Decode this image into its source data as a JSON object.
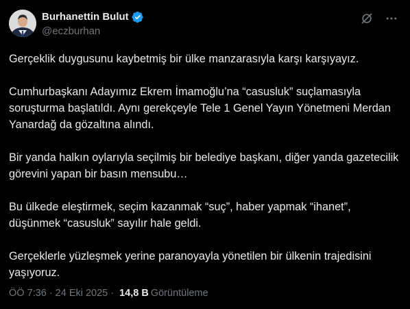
{
  "author": {
    "display_name": "Burhanettin Bulut",
    "handle": "@eczburhan",
    "verified_color": "#1d9bf0"
  },
  "header_actions": [
    "grok-icon",
    "more-icon"
  ],
  "post": {
    "paragraphs": [
      "Gerçeklik duygusunu kaybetmiş bir ülke manzarasıyla karşı karşıyayız.",
      "Cumhurbaşkanı Adayımız Ekrem İmamoğlu’na “casusluk” suçlamasıyla soruşturma başlatıldı. Aynı gerekçeyle Tele 1 Genel Yayın Yönetmeni Merdan Yanardağ da gözaltına alındı.",
      "Bir yanda halkın oylarıyla seçilmiş bir belediye başkanı, diğer yanda gazetecilik görevini yapan bir basın mensubu…",
      "Bu ülkede eleştirmek, seçim kazanmak “suç”, haber yapmak “ihanet”, düşünmek “casusluk” sayılır hale geldi.",
      "Gerçeklerle yüzleşmek yerine paranoyayla yönetilen bir ülkenin trajedisini yaşıyoruz."
    ]
  },
  "meta": {
    "time": "ÖÖ 7:36",
    "separator": "·",
    "date": "24 Eki 2025",
    "views_count": "14,8 B",
    "views_label": "Görüntüleme"
  },
  "colors": {
    "background": "#000000",
    "text": "#e7e9ea",
    "secondary": "#71767b",
    "accent": "#1d9bf0"
  }
}
